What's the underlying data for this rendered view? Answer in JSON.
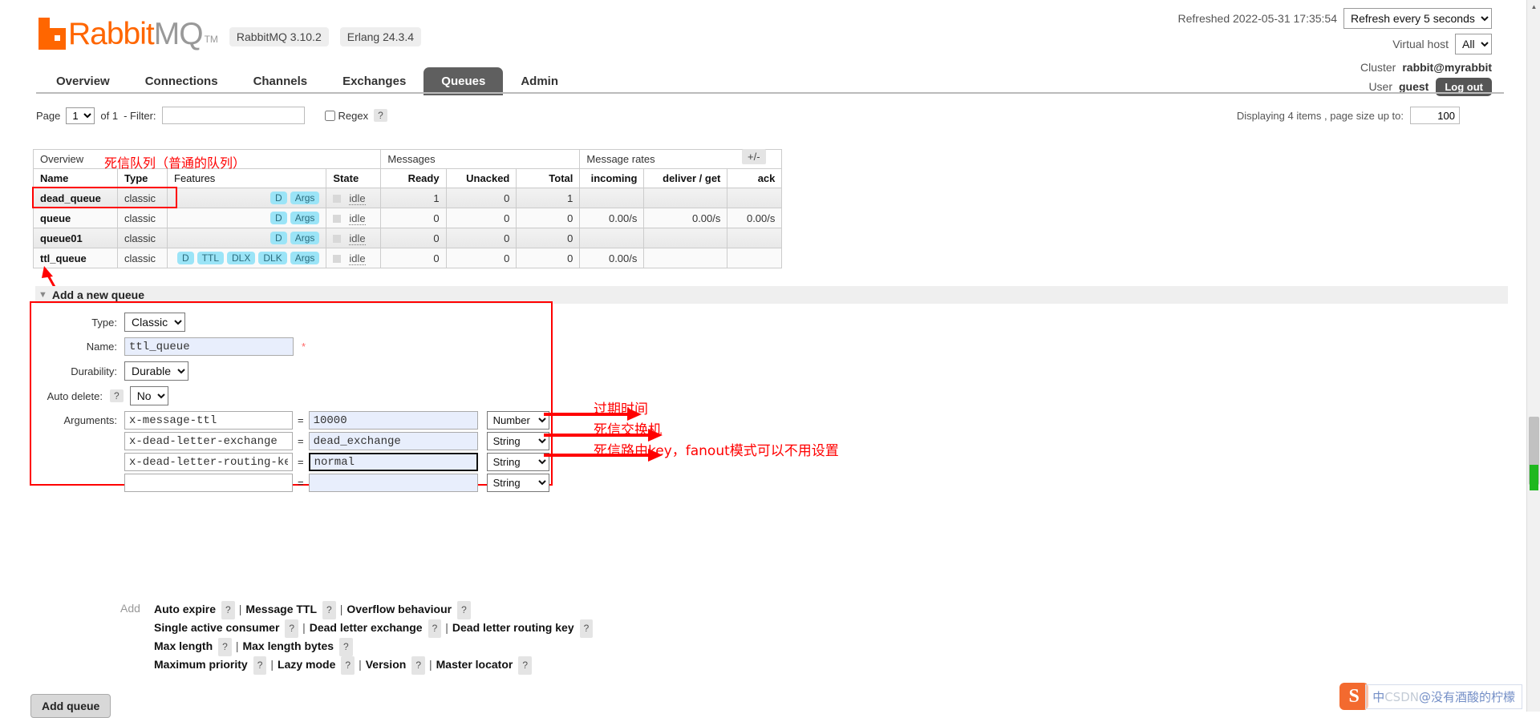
{
  "header": {
    "logo_text_primary": "Rabbit",
    "logo_text_secondary": "MQ",
    "logo_tm": "TM",
    "version_pill": "RabbitMQ 3.10.2",
    "erlang_pill": "Erlang 24.3.4",
    "refreshed_label": "Refreshed 2022-05-31 17:35:54",
    "refresh_selected": "Refresh every 5 seconds",
    "vhost_label": "Virtual host",
    "vhost_selected": "All",
    "cluster_label": "Cluster",
    "cluster_name": "rabbit@myrabbit",
    "user_label": "User",
    "user_name": "guest",
    "logout_label": "Log out"
  },
  "nav": {
    "tabs": [
      {
        "label": "Overview",
        "active": false
      },
      {
        "label": "Connections",
        "active": false
      },
      {
        "label": "Channels",
        "active": false
      },
      {
        "label": "Exchanges",
        "active": false
      },
      {
        "label": "Queues",
        "active": true
      },
      {
        "label": "Admin",
        "active": false
      }
    ]
  },
  "filter_bar": {
    "page_label": "Page",
    "page_value": "1",
    "of_label": "of 1",
    "filter_label": "- Filter:",
    "filter_value": "",
    "regex_label": "Regex",
    "help": "?",
    "displaying": "Displaying 4 items , page size up to:",
    "page_size": "100"
  },
  "queues_table": {
    "group_headers": [
      "Overview",
      "Messages",
      "Message rates"
    ],
    "plus_minus": "+/-",
    "columns": [
      "Name",
      "Type",
      "Features",
      "State",
      "Ready",
      "Unacked",
      "Total",
      "incoming",
      "deliver / get",
      "ack"
    ],
    "rows": [
      {
        "name": "dead_queue",
        "type": "classic",
        "features": [
          "D",
          "Args"
        ],
        "state": "idle",
        "ready": "1",
        "unacked": "0",
        "total": "1",
        "incoming": "",
        "deliver_get": "",
        "ack": ""
      },
      {
        "name": "queue",
        "type": "classic",
        "features": [
          "D",
          "Args"
        ],
        "state": "idle",
        "ready": "0",
        "unacked": "0",
        "total": "0",
        "incoming": "0.00/s",
        "deliver_get": "0.00/s",
        "ack": "0.00/s"
      },
      {
        "name": "queue01",
        "type": "classic",
        "features": [
          "D",
          "Args"
        ],
        "state": "idle",
        "ready": "0",
        "unacked": "0",
        "total": "0",
        "incoming": "",
        "deliver_get": "",
        "ack": ""
      },
      {
        "name": "ttl_queue",
        "type": "classic",
        "features": [
          "D",
          "TTL",
          "DLX",
          "DLK",
          "Args"
        ],
        "state": "idle",
        "ready": "0",
        "unacked": "0",
        "total": "0",
        "incoming": "0.00/s",
        "deliver_get": "",
        "ack": ""
      }
    ]
  },
  "add_queue": {
    "section_title": "Add a new queue",
    "type_label": "Type:",
    "type_value": "Classic",
    "name_label": "Name:",
    "name_value": "ttl_queue",
    "required_mark": "*",
    "durability_label": "Durability:",
    "durability_value": "Durable",
    "autodelete_label": "Auto delete:",
    "autodelete_help": "?",
    "autodelete_value": "No",
    "arguments_label": "Arguments:",
    "arguments": [
      {
        "key": "x-message-ttl",
        "eq": "=",
        "value": "10000",
        "type": "Number",
        "focused": false
      },
      {
        "key": "x-dead-letter-exchange",
        "eq": "=",
        "value": "dead_exchange",
        "type": "String",
        "focused": false
      },
      {
        "key": "x-dead-letter-routing-key",
        "eq": "=",
        "value": "normal",
        "type": "String",
        "focused": true
      },
      {
        "key": "",
        "eq": "=",
        "value": "",
        "type": "String",
        "focused": false
      }
    ],
    "add_word": "Add",
    "quick_add_rows": [
      [
        "Auto expire",
        "Message TTL",
        "Overflow behaviour"
      ],
      [
        "Single active consumer",
        "Dead letter exchange",
        "Dead letter routing key"
      ],
      [
        "Max length",
        "Max length bytes"
      ],
      [
        "Maximum priority",
        "Lazy mode",
        "Version",
        "Master locator"
      ]
    ],
    "submit_label": "Add queue"
  },
  "annotations": {
    "table_header_note": "死信队列（普通的队列）",
    "ttl_note": "过期时间",
    "dlx_note": "死信交换机",
    "dlk_note": "死信路由key，fanout模式可以不用设置"
  },
  "watermark": {
    "logo_letter": "S",
    "text_prefix": "中",
    "text_grey": "CSDN",
    "text_suffix": "@没有酒酸的柠檬"
  }
}
